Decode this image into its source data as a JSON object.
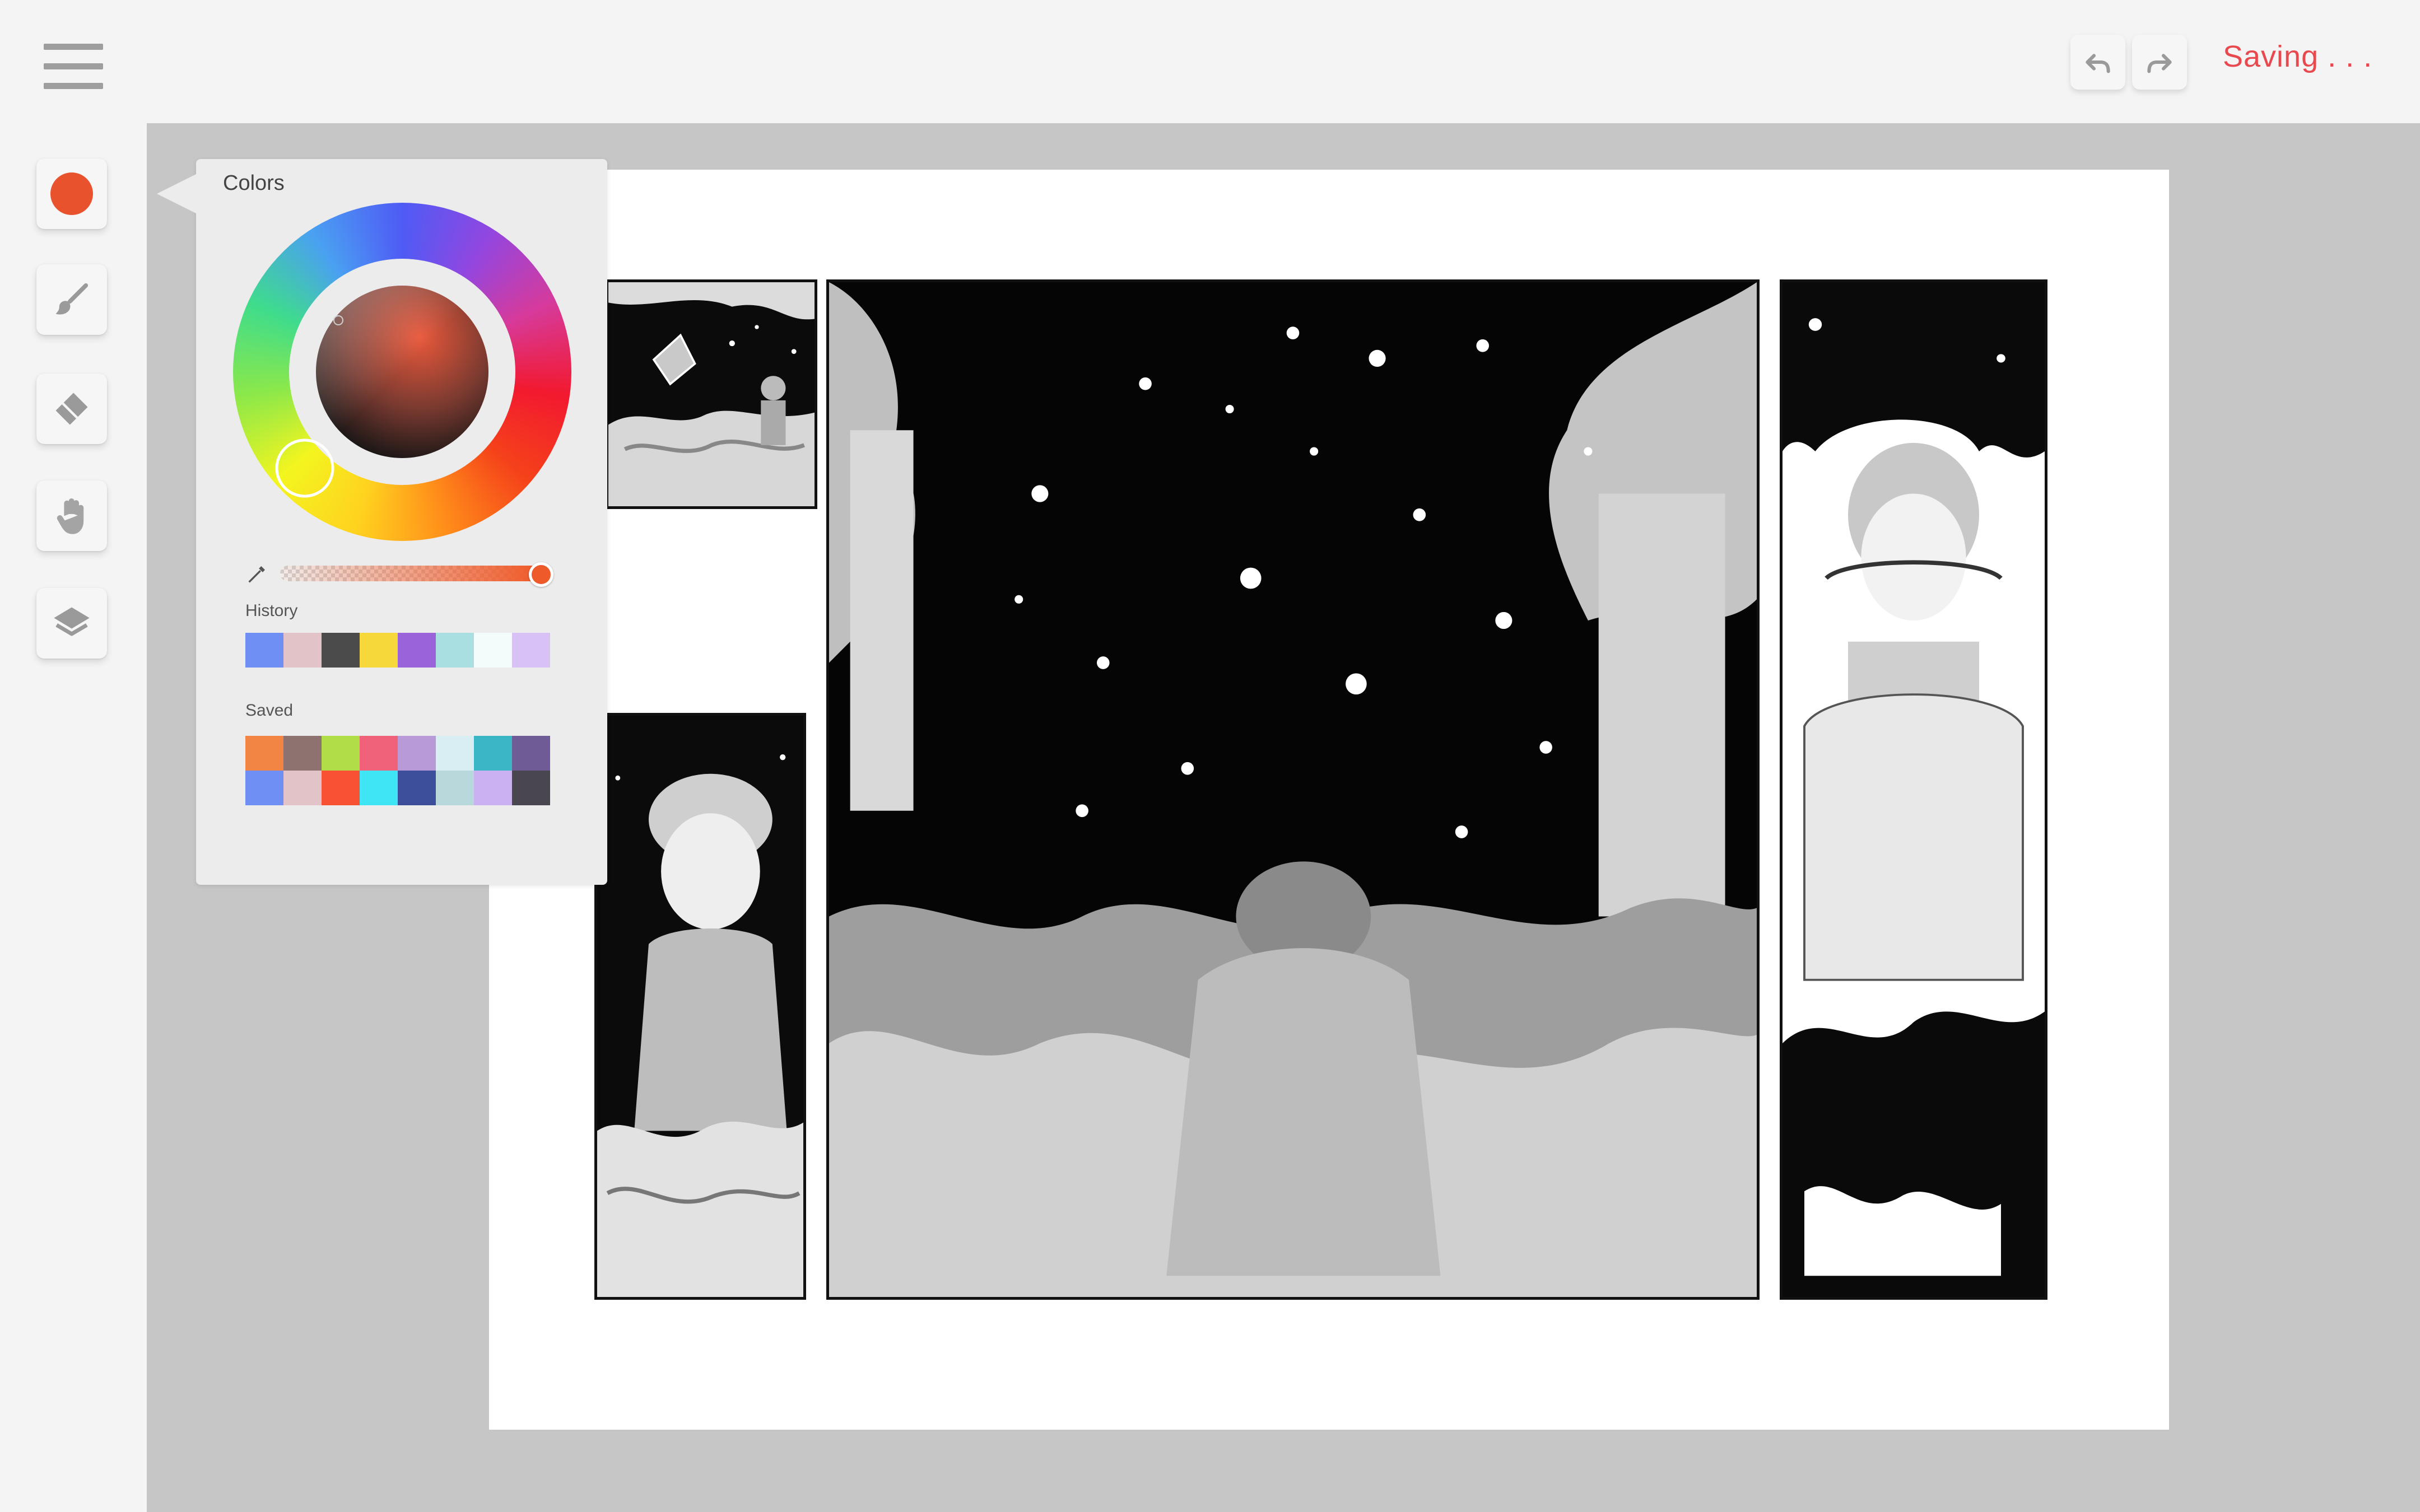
{
  "app": {
    "status_text": "Saving . . .",
    "accent_color": "#e8494f"
  },
  "icons": {
    "menu": "hamburger-menu-icon",
    "undo": "undo-arrow-icon",
    "redo": "redo-arrow-icon",
    "brush": "paintbrush-icon",
    "eraser": "eraser-icon",
    "hand": "hand-pan-icon",
    "layers": "layers-icon",
    "eyedropper": "eyedropper-icon"
  },
  "toolbar": {
    "current_color": "#e8532e",
    "tools": [
      "color",
      "brush",
      "eraser",
      "hand",
      "layers"
    ]
  },
  "colors_panel": {
    "title": "Colors",
    "selected_color": "#e8532e",
    "opacity_percent": 100,
    "history_label": "History",
    "history": [
      "#6f8ff5",
      "#e2c3c7",
      "#4b4b4b",
      "#f7d83a",
      "#9a63d9",
      "#a9dfe0",
      "#f4fbfb",
      "#d8c2f5"
    ],
    "saved_label": "Saved",
    "saved": [
      [
        "#f28444",
        "#8d7270",
        "#b1de46",
        "#f0617a",
        "#b79ad7",
        "#d9eef2",
        "#3bb6c7",
        "#6f5c97"
      ],
      [
        "#6f8ff5",
        "#e2c3c7",
        "#f75233",
        "#3fe4f5",
        "#3d4f9b",
        "#b8d8db",
        "#cbb1f1",
        "#4a4650"
      ]
    ]
  }
}
